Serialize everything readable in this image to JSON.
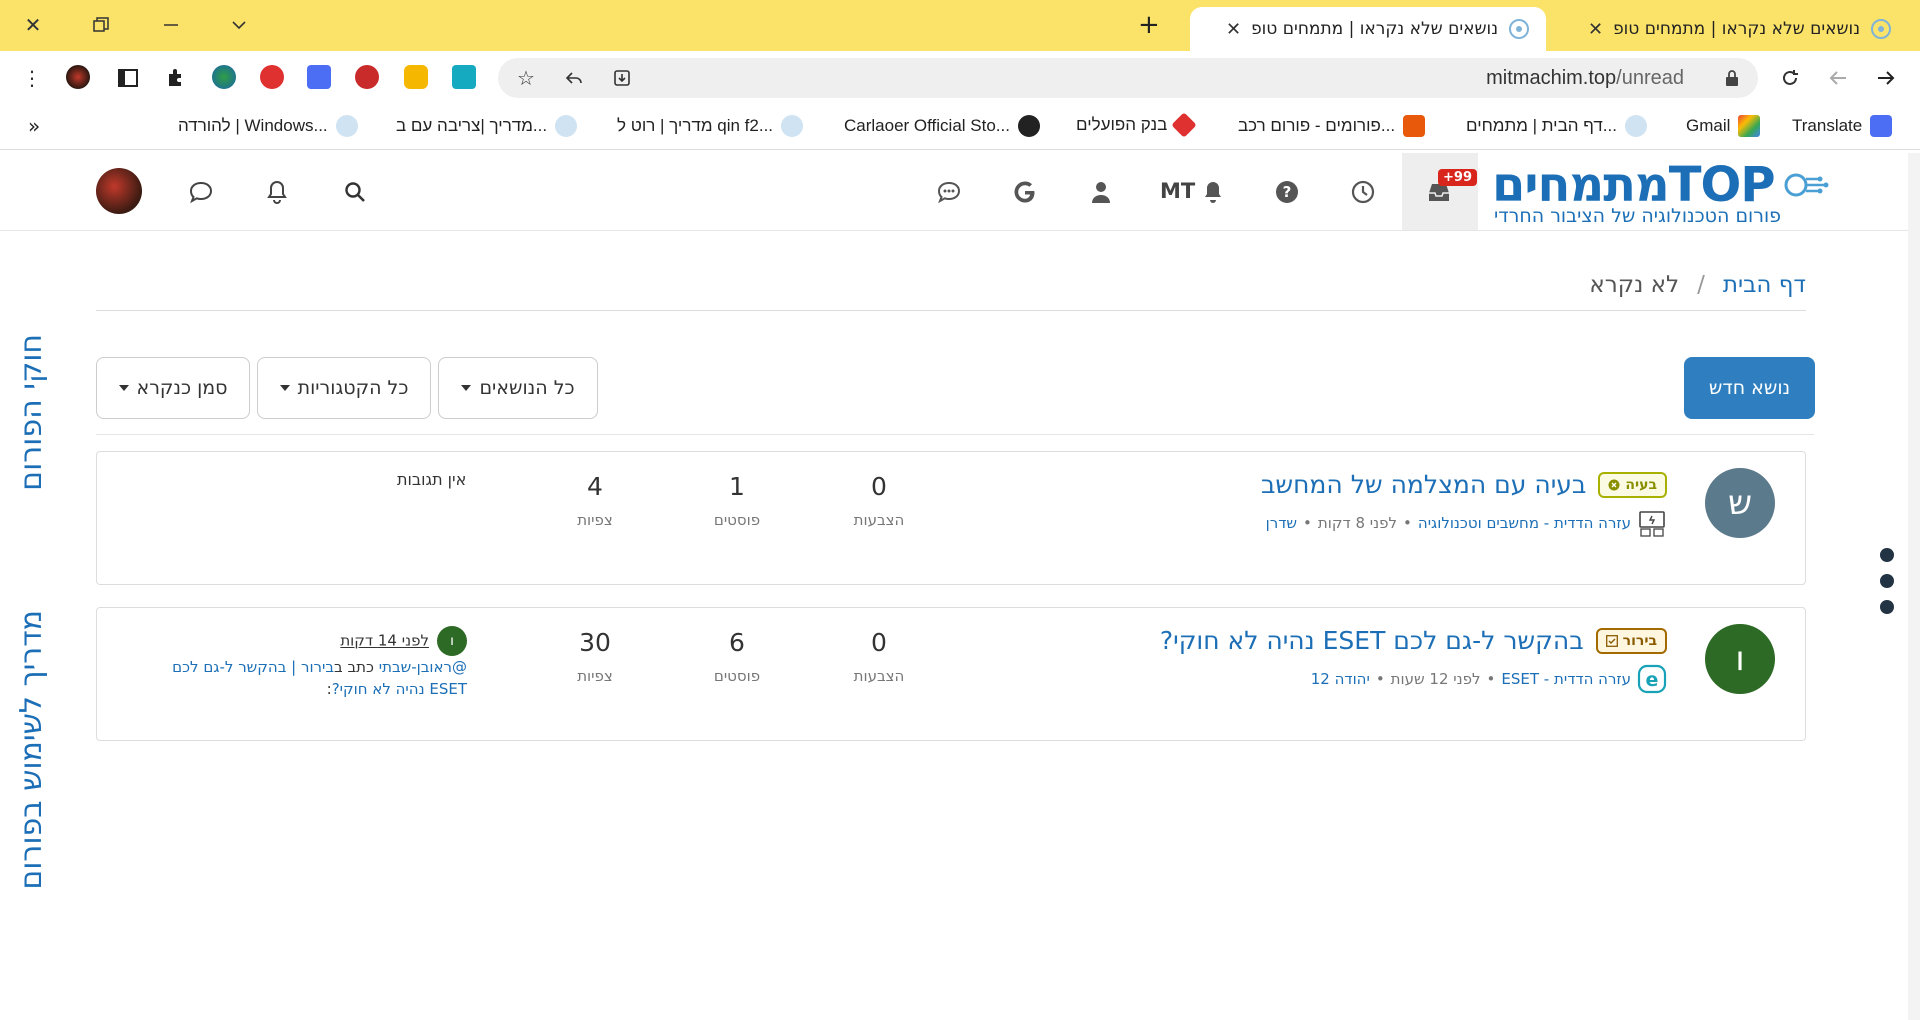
{
  "browser": {
    "tabs": [
      {
        "title": "נושאים שלא נקראו | מתמחים טופ",
        "active": false
      },
      {
        "title": "נושאים שלא נקראו | מתמחים טופ",
        "active": true
      }
    ],
    "url_host": "mitmachim.top",
    "url_path": "/unread",
    "bookmarks": [
      {
        "label": "Translate"
      },
      {
        "label": "Gmail"
      },
      {
        "label": "דף הבית | מתמחים..."
      },
      {
        "label": "פורומים - פורום רכב..."
      },
      {
        "label": "בנק הפועלים"
      },
      {
        "label": "Carlaoer Official Sto..."
      },
      {
        "label": "מדריך | רוט ל qin f2..."
      },
      {
        "label": "מדריך |צריבה עם ב..."
      },
      {
        "label": "להורדה | Windows..."
      }
    ],
    "bookmarks_more": "»"
  },
  "header": {
    "logo_main": "מתמחיםTOP",
    "logo_sub": "פורום הטכנולוגיה של הציבור החרדי",
    "inbox_badge": "+99",
    "mt_label": "MT"
  },
  "side_labels": {
    "forum_rules": "חוקי הפורום",
    "forum_guide": "מדריך לשימוש בפורום"
  },
  "breadcrumb": {
    "home": "דף הבית",
    "separator": "/",
    "current": "לא נקרא"
  },
  "toolbar": {
    "new_topic": "נושא חדש",
    "filter_topics": "כל הנושאים",
    "filter_categories": "כל הקטגוריות",
    "mark_read": "סמן כנקרא"
  },
  "topics": [
    {
      "avatar_letter": "ש",
      "avatar_color": "#5b7a8c",
      "badge": "בעיה",
      "badge_color": "#a8b000",
      "title": "בעיה עם המצלמה של המחשב",
      "category": "עזרה הדדית - מחשבים וטכנולוגיה",
      "time": "לפני 8 דקות",
      "author": "שדרן",
      "votes": "0",
      "votes_label": "הצבעות",
      "posts": "1",
      "posts_label": "פוסטים",
      "views": "4",
      "views_label": "צפיות",
      "no_replies": "אין תגובות"
    },
    {
      "avatar_letter": "ו",
      "avatar_color": "#2d6a25",
      "badge": "בירור",
      "badge_color": "#a36a00",
      "title": "בהקשר ל-גם לכם ESET נהיה לא חוקי?",
      "category": "עזרה הדדית - ESET",
      "time": "לפני 12 שעות",
      "author": "יהודה 12",
      "votes": "0",
      "votes_label": "הצבעות",
      "posts": "6",
      "posts_label": "פוסטים",
      "views": "30",
      "views_label": "צפיות",
      "teaser_time": "לפני 14 דקות",
      "teaser_user": "@ראובן-שבתי",
      "teaser_wrote": "כתב ב",
      "teaser_link": "בירור | בהקשר ל-גם לכם ESET נהיה לא חוקי?",
      "teaser_end": ":",
      "teaser_avatar": "ו"
    }
  ]
}
